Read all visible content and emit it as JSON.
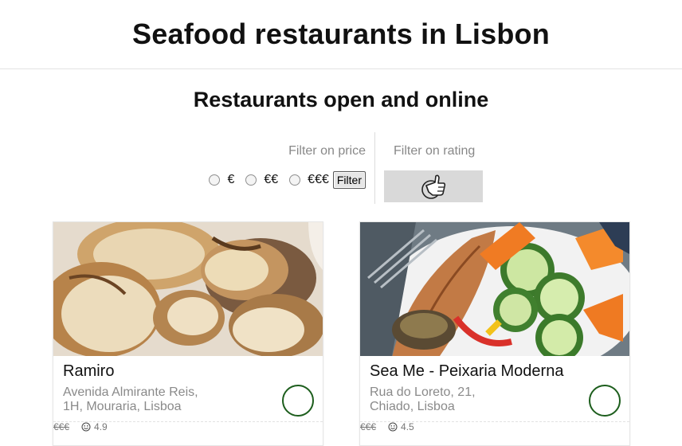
{
  "page": {
    "title": "Seafood restaurants in Lisbon",
    "subtitle": "Restaurants open and online"
  },
  "filters": {
    "price_label": "Filter on price",
    "rating_label": "Filter on rating",
    "price_options": [
      "€",
      "€€",
      "€€€"
    ],
    "filter_button": "Filter",
    "rating_icon": "thumbs-up-icon"
  },
  "restaurants": [
    {
      "name": "Ramiro",
      "address_line1": "Avenida Almirante Reis,",
      "address_line2": "1H, Mouraria, Lisboa",
      "price": "€€€",
      "rating": "4.9",
      "image": "bread-photo",
      "rating_icon": "smiley-icon"
    },
    {
      "name": "Sea Me - Peixaria Moderna",
      "address_line1": "Rua do Loreto, 21,",
      "address_line2": "Chiado, Lisboa",
      "price": "€€€",
      "rating": "4.5",
      "image": "grilled-fish-photo",
      "rating_icon": "smiley-icon"
    }
  ]
}
